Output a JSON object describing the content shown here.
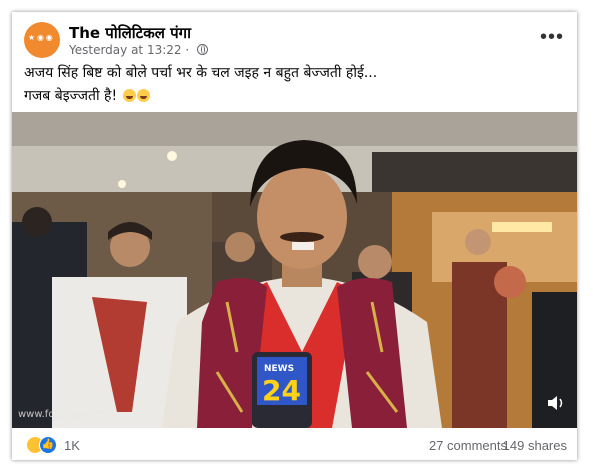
{
  "post": {
    "page_name": "The पोलिटिकल पंगा",
    "timestamp": "Yesterday at 13:22 ·",
    "privacy_icon": "globe-icon",
    "more_label": "•••",
    "caption_line1": "अजय सिंह बिष्ट को बोले पर्चा भर के चल जइह न बहुत बेज्जती होई...",
    "caption_line2": "गजब बेइज्जती है!"
  },
  "video": {
    "watermark": "www.fotohub.com",
    "mic_logo": "24",
    "mic_logo_prefix": "NEWS",
    "volume_icon": "speaker-icon"
  },
  "engagement": {
    "reaction_count": "1K",
    "comments": "27 comments",
    "shares": "149 shares",
    "reaction_icons": [
      "haha-icon",
      "like-icon"
    ]
  },
  "colors": {
    "page_name": "#050505",
    "meta": "#65676b",
    "like_blue": "#1b74e4",
    "haha_yellow": "#fcc233",
    "avatar_orange": "#f18a2f"
  }
}
